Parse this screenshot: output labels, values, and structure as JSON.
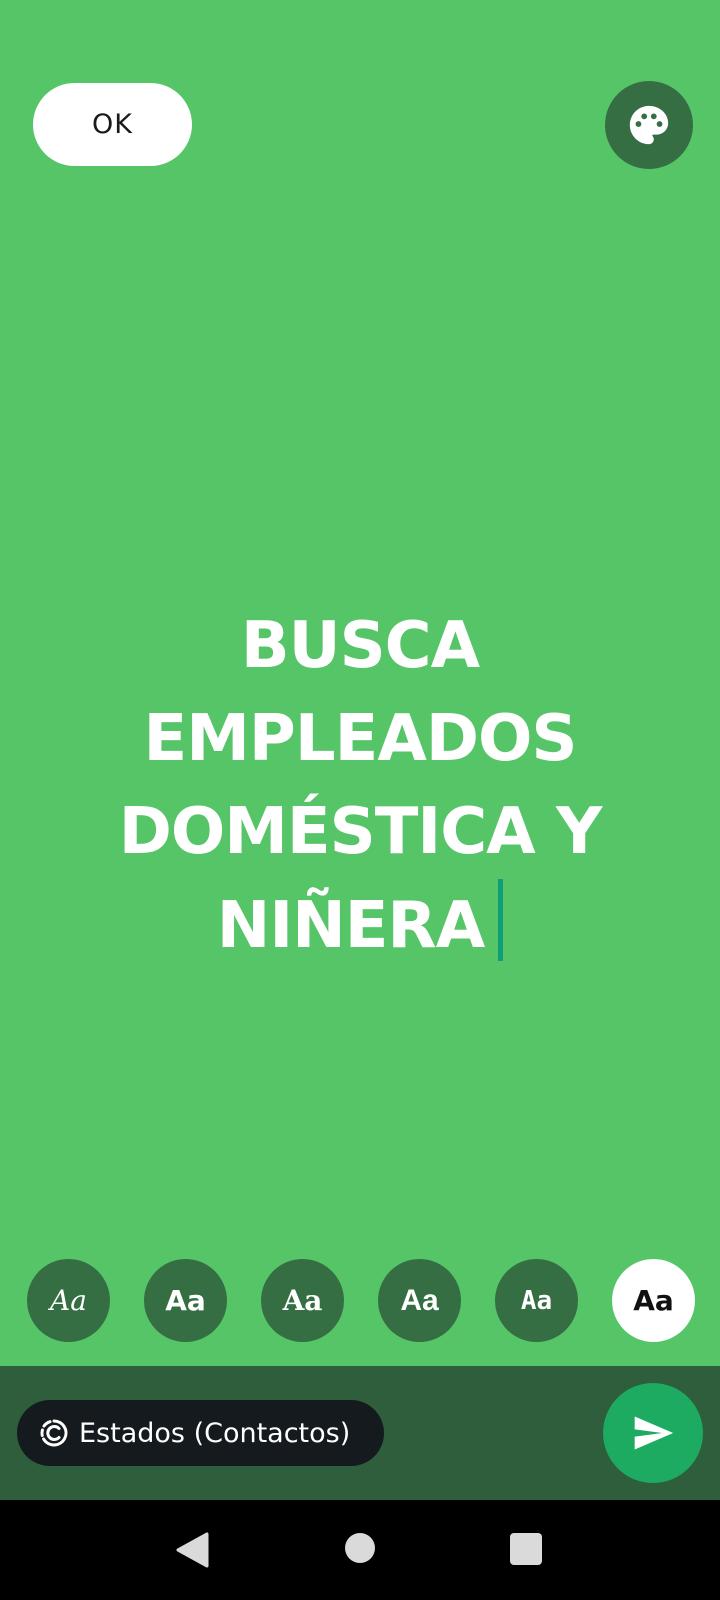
{
  "top_bar": {
    "ok_label": "OK",
    "palette_icon": "palette-icon"
  },
  "status_text": {
    "lines": [
      "BUSCA",
      "EMPLEADOS",
      "DOMÉSTICA Y",
      "NIÑERA"
    ]
  },
  "font_options": [
    {
      "label": "Aa",
      "selected": false
    },
    {
      "label": "Aa",
      "selected": false
    },
    {
      "label": "Aa",
      "selected": false
    },
    {
      "label": "Aa",
      "selected": false
    },
    {
      "label": "Aa",
      "selected": false
    },
    {
      "label": "Aa",
      "selected": true
    }
  ],
  "bottom_bar": {
    "audience_label": "Estados (Contactos)",
    "audience_icon": "status-ring-icon",
    "send_icon": "send-icon"
  },
  "colors": {
    "background": "#56C568",
    "dark_green": "#356E43",
    "bottom_bar": "#2E5E3B",
    "send_green": "#1DAA61",
    "caret": "#0F9E78"
  }
}
